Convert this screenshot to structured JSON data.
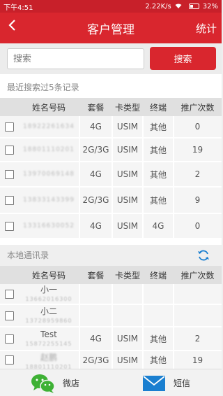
{
  "status": {
    "time": "下午4:51",
    "speed": "2.22K/s",
    "battery": "32%"
  },
  "titlebar": {
    "back": "<",
    "title": "客户管理",
    "right": "统计"
  },
  "search": {
    "placeholder": "搜索",
    "button": "搜索"
  },
  "recent": {
    "label": "最近搜索过5条记录",
    "headers": [
      "姓名号码",
      "套餐",
      "卡类型",
      "终端",
      "推广次数"
    ],
    "rows": [
      {
        "name": "18922261634",
        "plan": "4G",
        "card": "USIM",
        "term": "其他",
        "count": "0"
      },
      {
        "name": "18801110201",
        "plan": "2G/3G",
        "card": "USIM",
        "term": "其他",
        "count": "19"
      },
      {
        "name": "13970069148",
        "plan": "4G",
        "card": "USIM",
        "term": "其他",
        "count": "2"
      },
      {
        "name": "13833143399",
        "plan": "2G/3G",
        "card": "USIM",
        "term": "其他",
        "count": "9"
      },
      {
        "name": "13316630052",
        "plan": "4G",
        "card": "USIM",
        "term": "4G",
        "count": "0"
      }
    ]
  },
  "contacts": {
    "label": "本地通讯录",
    "headers": [
      "姓名号码",
      "套餐",
      "卡类型",
      "终端",
      "推广次数"
    ],
    "rows": [
      {
        "name": "小一",
        "phone": "13662016300",
        "plan": "",
        "card": "",
        "term": "",
        "count": ""
      },
      {
        "name": "小二",
        "phone": "13728959860",
        "plan": "",
        "card": "",
        "term": "",
        "count": ""
      },
      {
        "name": "Test",
        "phone": "15872255145",
        "plan": "4G",
        "card": "USIM",
        "term": "其他",
        "count": "2"
      },
      {
        "name": "赵鹏",
        "phone": "18801110201",
        "plan": "2G/3G",
        "card": "USIM",
        "term": "其他",
        "count": "19"
      }
    ]
  },
  "bottom": {
    "wechat": "微店",
    "sms": "短信"
  },
  "colors": {
    "accent": "#d9262e",
    "wechat": "#3eb135",
    "sms": "#1a7fd0"
  },
  "icons": {
    "back": "chevron-left-icon",
    "refresh": "refresh-icon",
    "wechat": "wechat-icon",
    "sms": "envelope-icon"
  }
}
